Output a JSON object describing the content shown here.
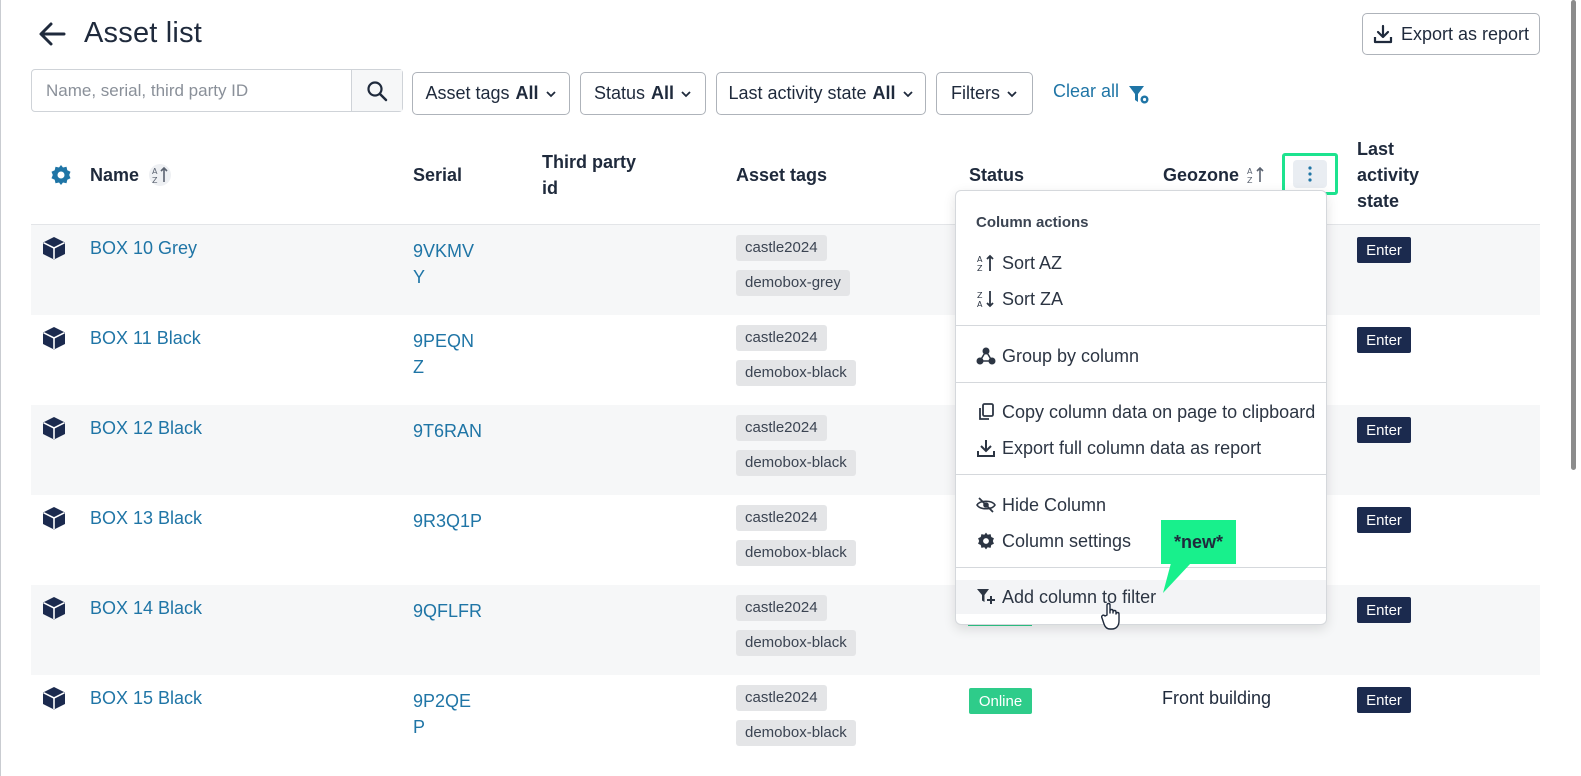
{
  "header": {
    "title": "Asset list",
    "export_label": "Export as report"
  },
  "search": {
    "placeholder": "Name, serial, third party ID"
  },
  "filters": {
    "asset_tags": {
      "label": "Asset tags",
      "value": "All"
    },
    "status": {
      "label": "Status",
      "value": "All"
    },
    "last_activity": {
      "label": "Last activity state",
      "value": "All"
    },
    "more": "Filters",
    "clear_all": "Clear all"
  },
  "columns": {
    "name": "Name",
    "serial": "Serial",
    "third_party_line1": "Third party",
    "third_party_line2": "id",
    "asset_tags": "Asset tags",
    "status": "Status",
    "geozone": "Geozone",
    "last_activity_line1": "Last",
    "last_activity_line2": "activity",
    "last_activity_line3": "state"
  },
  "rows": [
    {
      "name": "BOX 10 Grey",
      "serial": "9VKMVY",
      "tags": [
        "castle2024",
        "demobox-grey"
      ],
      "status": "",
      "geozone": "",
      "action": "Enter"
    },
    {
      "name": "BOX 11 Black",
      "serial": "9PEQNZ",
      "tags": [
        "castle2024",
        "demobox-black"
      ],
      "status": "",
      "geozone": "",
      "action": "Enter"
    },
    {
      "name": "BOX 12 Black",
      "serial": "9T6RAN",
      "tags": [
        "castle2024",
        "demobox-black"
      ],
      "status": "",
      "geozone": "",
      "action": "Enter"
    },
    {
      "name": "BOX 13 Black",
      "serial": "9R3Q1P",
      "tags": [
        "castle2024",
        "demobox-black"
      ],
      "status": "",
      "geozone": "",
      "action": "Enter"
    },
    {
      "name": "BOX 14 Black",
      "serial": "9QFLFR",
      "tags": [
        "castle2024",
        "demobox-black"
      ],
      "status": "",
      "geozone": "",
      "action": "Enter"
    },
    {
      "name": "BOX 15 Black",
      "serial": "9P2QEP",
      "tags": [
        "castle2024",
        "demobox-black"
      ],
      "status": "Online",
      "geozone": "Front building",
      "action": "Enter"
    }
  ],
  "column_menu": {
    "heading": "Column actions",
    "sort_az": "Sort AZ",
    "sort_za": "Sort ZA",
    "group_by": "Group by column",
    "copy_data": "Copy column data on page to clipboard",
    "export_data": "Export full column data as report",
    "hide_column": "Hide Column",
    "column_settings": "Column settings",
    "add_to_filter": "Add column to filter"
  },
  "callout": {
    "label": "*new*",
    "color": "#18f08c"
  },
  "colors": {
    "link": "#1f75a6",
    "navy": "#1b2a4e",
    "online": "#2ecc8a",
    "highlight": "#1de38f"
  }
}
